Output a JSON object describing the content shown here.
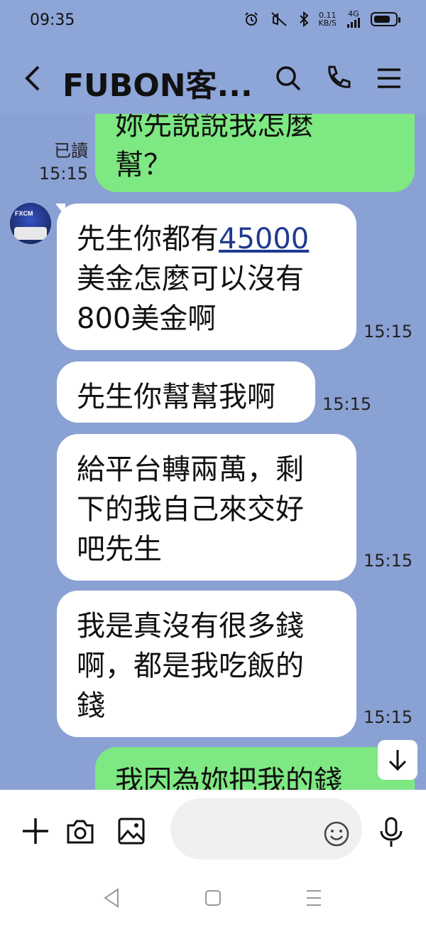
{
  "status_bar": {
    "time": "09:35",
    "net_speed": "0.11",
    "net_unit": "KB/S",
    "signal_label": "4G",
    "battery_level": 0.8
  },
  "header": {
    "title": "FUBON客..."
  },
  "messages": [
    {
      "direction": "out",
      "text": "妳先說說我怎麼\n幫？",
      "read_label": "已讀",
      "time": "15:15"
    },
    {
      "direction": "in",
      "text_before": "先生你都有",
      "link_text": "45000",
      "text_after": "\n美金怎麼可以沒有\n800美金啊",
      "time": "15:15"
    },
    {
      "direction": "in",
      "text": "先生你幫幫我啊",
      "time": "15:15"
    },
    {
      "direction": "in",
      "text": "給平台轉兩萬，剩\n下的我自己來交好\n吧先生",
      "time": "15:15"
    },
    {
      "direction": "in",
      "text": "我是真沒有很多錢\n啊，都是我吃飯的\n錢",
      "time": "15:15"
    },
    {
      "direction": "out",
      "text": "我因為妳把我的錢",
      "time": ""
    }
  ],
  "avatar": {
    "label": "FXCM"
  },
  "input": {
    "placeholder": ""
  },
  "colors": {
    "chat_bg": "#8aa1d4",
    "out_bubble": "#7ee882",
    "in_bubble": "#ffffff"
  }
}
